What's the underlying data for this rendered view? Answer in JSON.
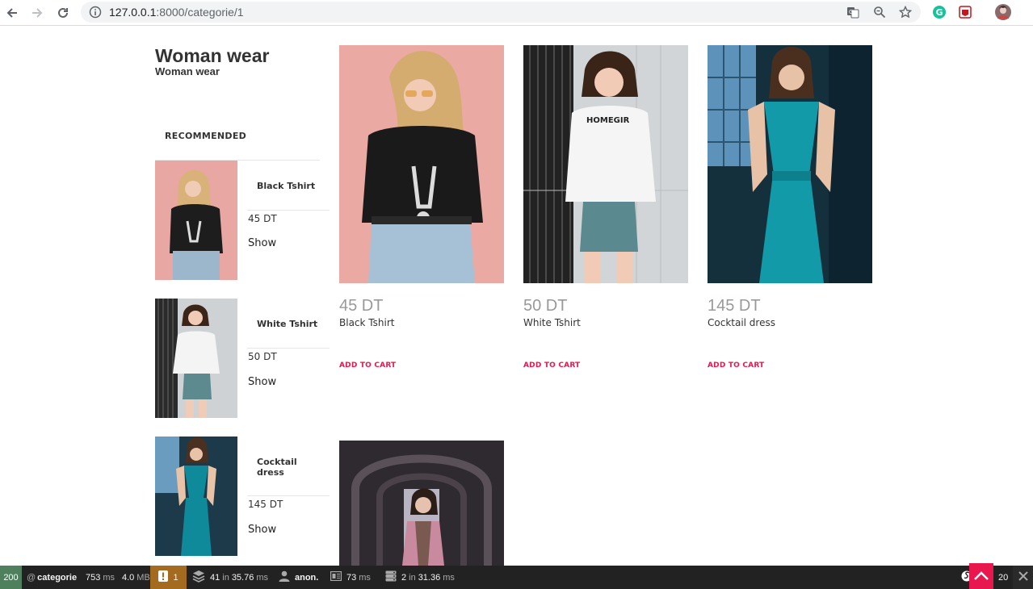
{
  "browser": {
    "url_host": "127.0.0.1",
    "url_path": ":8000/categorie/1",
    "icons": [
      "back-icon",
      "forward-icon",
      "reload-icon",
      "info-icon",
      "translate-icon",
      "zoom-icon",
      "star-icon",
      "grammarly-icon",
      "extension-icon",
      "profile-avatar"
    ]
  },
  "category": {
    "title": "Woman wear",
    "subtitle": "Woman wear"
  },
  "recommended": {
    "heading": "RECOMMENDED",
    "items": [
      {
        "name": "Black Tshirt",
        "price": "45 DT",
        "action": "Show"
      },
      {
        "name": "White Tshirt",
        "price": "50 DT",
        "action": "Show"
      },
      {
        "name": "Cocktail dress",
        "price": "145 DT",
        "action": "Show"
      }
    ]
  },
  "products": [
    {
      "price": "45 DT",
      "name": "Black Tshirt",
      "cta": "ADD TO CART"
    },
    {
      "price": "50 DT",
      "name": "White Tshirt",
      "cta": "ADD TO CART"
    },
    {
      "price": "145 DT",
      "name": "Cocktail dress",
      "cta": "ADD TO CART"
    }
  ],
  "toolbar": {
    "status": "200",
    "route_prefix": "@",
    "route": "categorie",
    "time": "753",
    "time_unit": "ms",
    "memory": "4.0",
    "memory_unit": "MB",
    "warnings": "1",
    "db_queries": "41",
    "db_in": "in",
    "db_time": "35.76",
    "db_unit": "ms",
    "user": "anon.",
    "twig_time": "73",
    "twig_unit": "ms",
    "cache_calls": "2",
    "cache_in": "in",
    "cache_time": "31.36",
    "cache_unit": "ms",
    "symfony_version": "20"
  },
  "colors": {
    "accent": "#e8174d",
    "status_ok": "#4f805d",
    "warning": "#a46a1f",
    "toolbar_bg": "#222222",
    "price_grey": "#999999"
  }
}
